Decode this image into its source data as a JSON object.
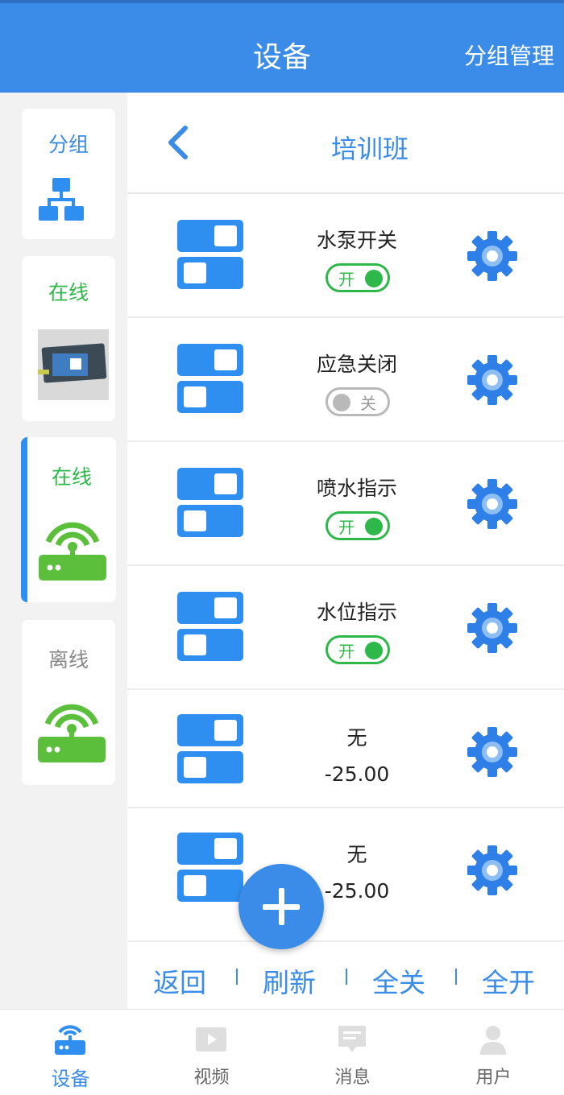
{
  "header": {
    "title": "设备",
    "right_action": "分组管理"
  },
  "sidebar": {
    "items": [
      {
        "label": "分组",
        "icon": "hierarchy-icon",
        "status": "group"
      },
      {
        "label": "在线",
        "icon": "device-photo",
        "status": "online"
      },
      {
        "label": "在线",
        "icon": "router-icon",
        "status": "online",
        "selected": true
      },
      {
        "label": "离线",
        "icon": "router-icon",
        "status": "offline"
      }
    ]
  },
  "group": {
    "title": "培训班",
    "back_icon": "chevron-left-icon"
  },
  "devices": [
    {
      "name": "水泵开关",
      "switch_label": "开",
      "on": true
    },
    {
      "name": "应急关闭",
      "switch_label": "关",
      "on": false
    },
    {
      "name": "喷水指示",
      "switch_label": "开",
      "on": true
    },
    {
      "name": "水位指示",
      "switch_label": "开",
      "on": true
    },
    {
      "name": "无",
      "value": "-25.00"
    },
    {
      "name": "无",
      "value": "-25.00"
    }
  ],
  "actions": {
    "back": "返回",
    "refresh": "刷新",
    "all_off": "全关",
    "all_on": "全开"
  },
  "tabs": [
    {
      "label": "设备",
      "icon": "device-icon",
      "active": true
    },
    {
      "label": "视频",
      "icon": "video-icon"
    },
    {
      "label": "消息",
      "icon": "message-icon"
    },
    {
      "label": "用户",
      "icon": "user-icon"
    }
  ],
  "colors": {
    "primary": "#3a8ce8",
    "online": "#2eb84a",
    "offline": "#888888",
    "router_green": "#5cbf3b"
  }
}
